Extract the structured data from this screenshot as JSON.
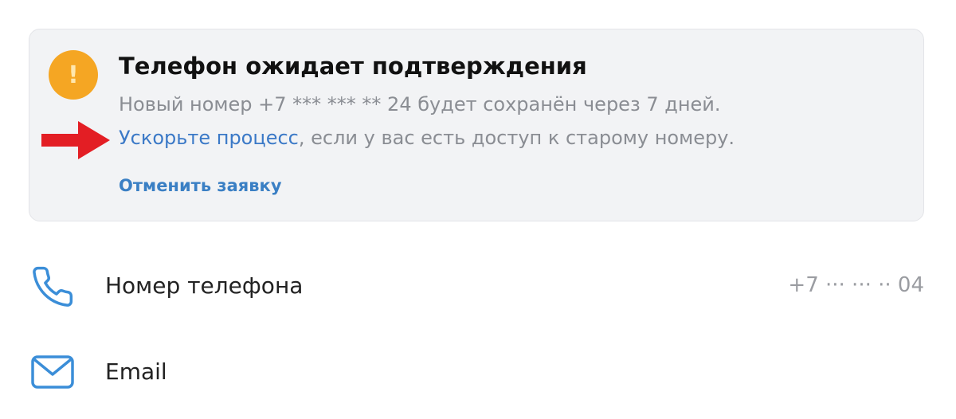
{
  "notice": {
    "badge_symbol": "!",
    "title": "Телефон ожидает подтверждения",
    "line1": "Новый номер +7 *** *** ** 24 будет сохранён через 7 дней.",
    "speed_up_link": "Ускорьте процесс",
    "line2_rest": ", если у вас есть доступ к старому номеру.",
    "cancel_link": "Отменить заявку",
    "badge_color": "#f5a623",
    "link_color": "#3b79c7",
    "arrow_color": "#e31e24"
  },
  "rows": {
    "phone": {
      "icon": "phone-icon",
      "label": "Номер телефона",
      "value": "+7 ··· ··· ·· 04"
    },
    "email": {
      "icon": "mail-icon",
      "label": "Email"
    }
  }
}
